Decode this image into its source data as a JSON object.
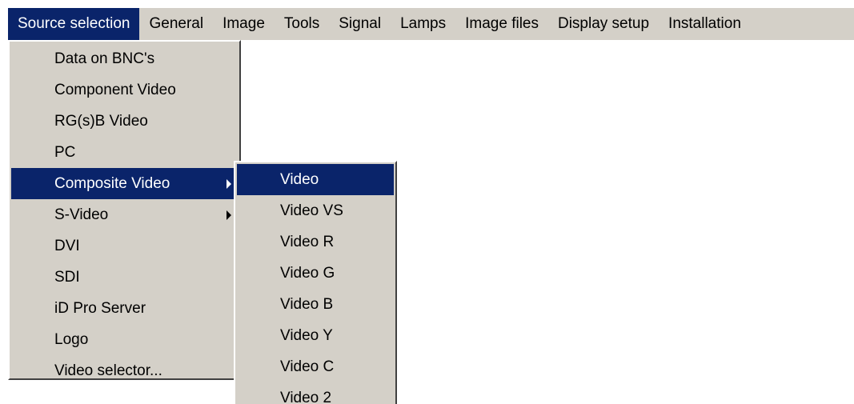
{
  "menubar": {
    "items": [
      {
        "label": "Source selection",
        "active": true
      },
      {
        "label": "General"
      },
      {
        "label": "Image"
      },
      {
        "label": "Tools"
      },
      {
        "label": "Signal"
      },
      {
        "label": "Lamps"
      },
      {
        "label": "Image files"
      },
      {
        "label": "Display setup"
      },
      {
        "label": "Installation"
      }
    ]
  },
  "source_menu": {
    "items": [
      {
        "label": "Data on BNC's"
      },
      {
        "label": "Component Video"
      },
      {
        "label": "RG(s)B Video"
      },
      {
        "label": "PC"
      },
      {
        "label": "Composite Video",
        "has_submenu": true,
        "selected": true
      },
      {
        "label": "S-Video",
        "has_submenu": true
      },
      {
        "label": "DVI"
      },
      {
        "label": "SDI"
      },
      {
        "label": "iD Pro Server"
      },
      {
        "label": "Logo"
      },
      {
        "label": "Video selector..."
      }
    ]
  },
  "composite_submenu": {
    "items": [
      {
        "label": "Video",
        "selected": true
      },
      {
        "label": "Video VS"
      },
      {
        "label": "Video R"
      },
      {
        "label": "Video G"
      },
      {
        "label": "Video B"
      },
      {
        "label": "Video Y"
      },
      {
        "label": "Video C"
      },
      {
        "label": "Video 2"
      }
    ]
  },
  "colors": {
    "menu_background": "#d4d0c8",
    "highlight": "#0a246a",
    "highlight_text": "#ffffff"
  }
}
